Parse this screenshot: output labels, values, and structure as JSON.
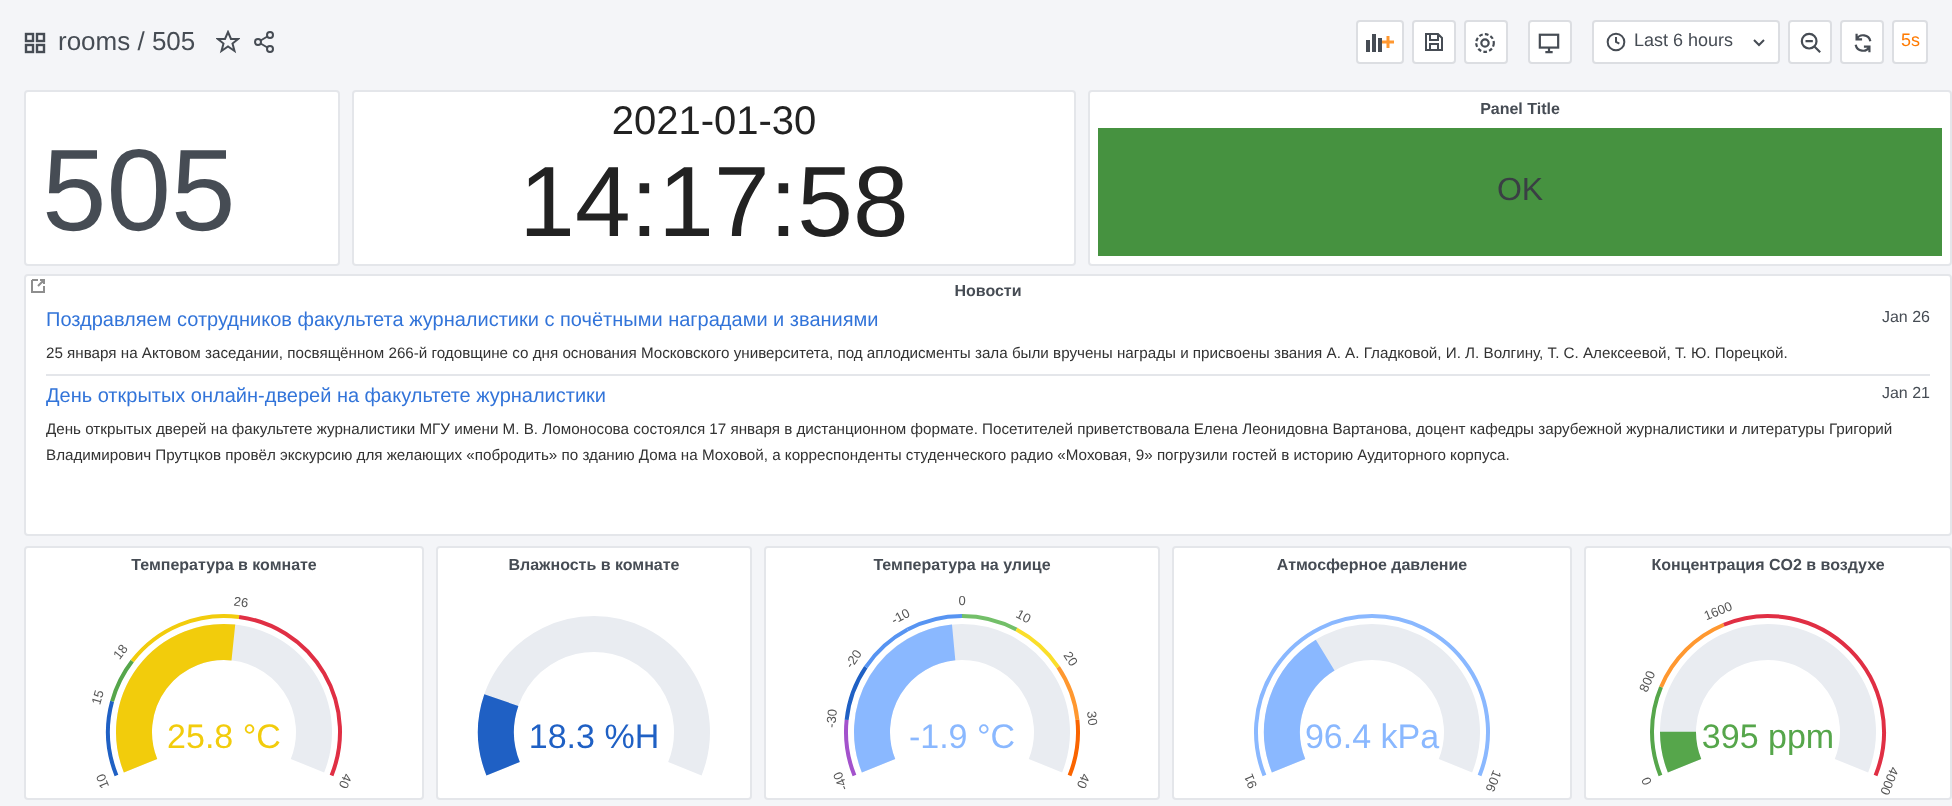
{
  "dashboard": {
    "title": "rooms / 505"
  },
  "toolbar": {
    "time_range": "Last 6 hours",
    "refresh_interval": "5s"
  },
  "stat_panel": {
    "value": "505"
  },
  "clock_panel": {
    "date": "2021-01-30",
    "time": "14:17:58"
  },
  "status_panel": {
    "title": "Panel Title",
    "value": "OK"
  },
  "news": {
    "title": "Новости",
    "items": [
      {
        "title": "Поздравляем сотрудников факультета журналистики с почётными наградами и званиями",
        "date": "Jan 26",
        "text": "25 января на Актовом заседании, посвящённом 266-й годовщине со дня основания Московского университета, под аплодисменты зала были вручены награды и присвоены звания А. А. Гладковой, И. Л. Волгину, Т. С. Алексеевой, Т. Ю. Порецкой."
      },
      {
        "title": "День открытых онлайн-дверей на факультете журналистики",
        "date": "Jan 21",
        "text": "День открытых дверей на факультете журналистики МГУ имени М. В. Ломоносова состоялся 17 января в дистанционном формате. Посетителей приветствовала Елена Леонидовна Вартанова, доцент кафедры зарубежной журналистики и литературы Григорий Владимирович Прутцков провёл экскурсию для желающих «побродить» по зданию Дома на Моховой, а корреспонденты студенческого радио «Моховая, 9» погрузили гостей в историю Аудиторного корпуса."
      }
    ]
  },
  "gauges": [
    {
      "title": "Температура в комнате",
      "value": "25.8 °C",
      "color": "#f2cc0c",
      "ticks": [
        "10",
        "15",
        "18",
        "26",
        "40"
      ],
      "bands": [
        {
          "color": "#1f60c4"
        },
        {
          "color": "#56a64b"
        },
        {
          "color": "#f2cc0c"
        },
        {
          "color": "#e02f44"
        }
      ]
    },
    {
      "title": "Влажность в комнате",
      "value": "18.3 %H",
      "color": "#1f60c4"
    },
    {
      "title": "Температура на улице",
      "value": "-1.9 °C",
      "color": "#8ab8ff",
      "ticks": [
        "-40",
        "-30",
        "-20",
        "-10",
        "0",
        "10",
        "20",
        "30",
        "40"
      ],
      "bands": [
        {
          "color": "#a352cc"
        },
        {
          "color": "#1f60c4"
        },
        {
          "color": "#5794f2"
        },
        {
          "color": "#5794f2"
        },
        {
          "color": "#73bf69"
        },
        {
          "color": "#fade2a"
        },
        {
          "color": "#ff9830"
        },
        {
          "color": "#fa6400"
        }
      ]
    },
    {
      "title": "Атмосферное давление",
      "value": "96.4 kPa",
      "color": "#8ab8ff",
      "ticks": [
        "91",
        "106"
      ],
      "bands": [
        {
          "color": "#8ab8ff"
        }
      ]
    },
    {
      "title": "Концентрация CO2 в воздухе",
      "value": "395 ppm",
      "color": "#56a64b",
      "ticks": [
        "0",
        "800",
        "1600",
        "4000"
      ],
      "bands": [
        {
          "color": "#56a64b"
        },
        {
          "color": "#ff9830"
        },
        {
          "color": "#e02f44"
        }
      ]
    }
  ]
}
